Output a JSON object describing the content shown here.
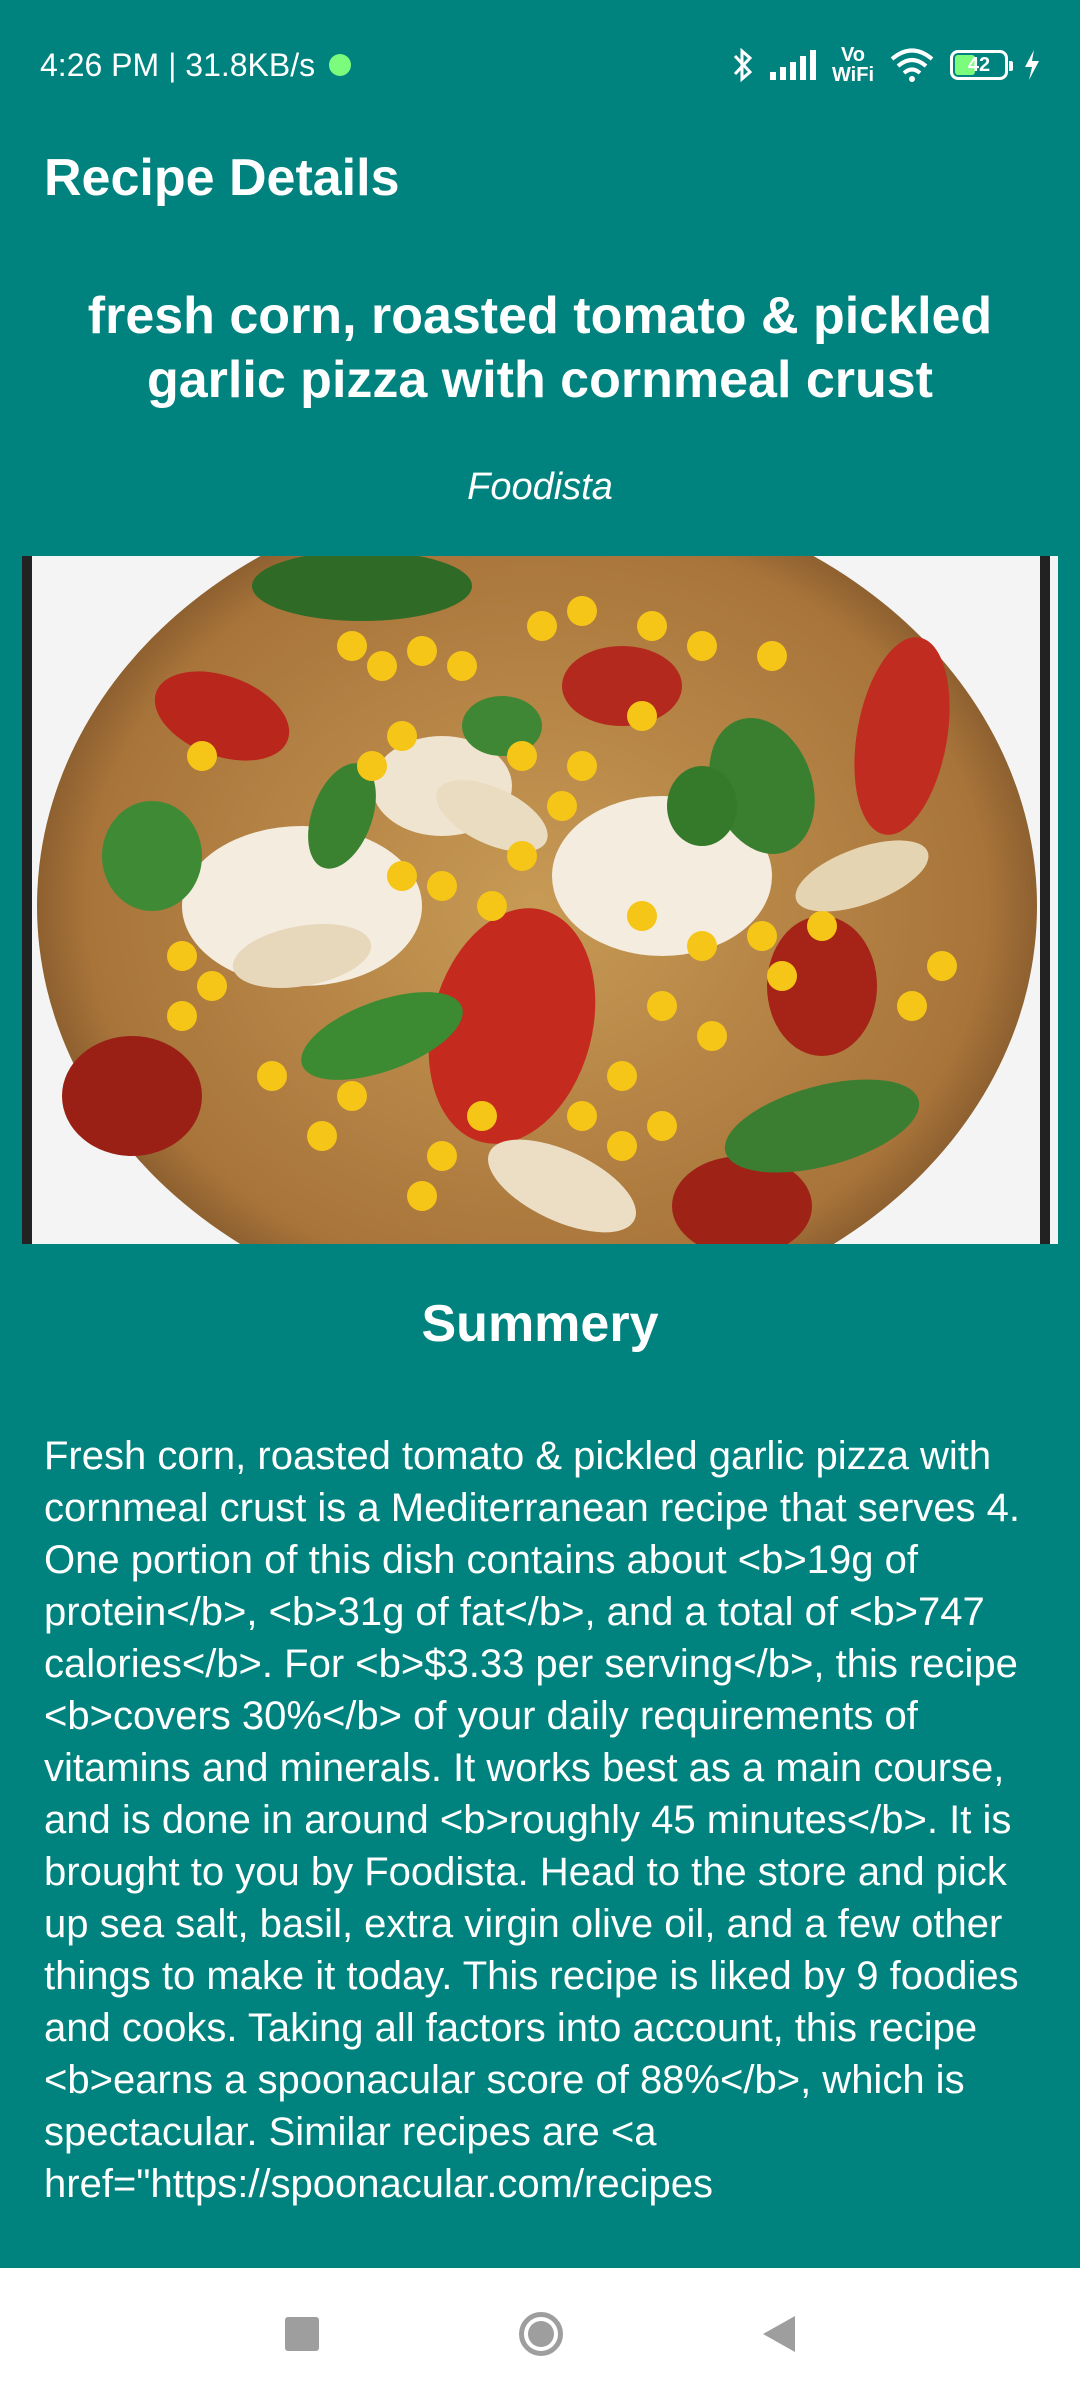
{
  "status_bar": {
    "time_speed": "4:26 PM | 31.8KB/s",
    "vowifi_line1": "Vo",
    "vowifi_line2": "WiFi",
    "battery_level": "42",
    "battery_fraction": 0.42,
    "icons": [
      "notification-dot-icon",
      "bluetooth-icon",
      "signal-icon",
      "wifi-icon",
      "battery-icon",
      "charging-icon"
    ]
  },
  "app_bar": {
    "title": "Recipe Details"
  },
  "recipe": {
    "title": "fresh corn, roasted tomato & pickled garlic pizza with cornmeal crust",
    "source": "Foodista",
    "summary_heading": "Summery",
    "summary": "Fresh corn, roasted tomato & pickled garlic pizza with cornmeal crust is a Mediterranean recipe that serves 4. One portion of this dish contains about <b>19g of protein</b>, <b>31g of fat</b>, and a total of <b>747 calories</b>. For <b>$3.33 per serving</b>, this recipe <b>covers 30%</b> of your daily requirements of vitamins and minerals. It works best as a main course, and is done in around <b>roughly 45 minutes</b>. It is brought to you by Foodista. Head to the store and pick up sea salt, basil, extra virgin olive oil, and a few other things to make it today. This recipe is liked by 9 foodies and cooks. Taking all factors into account, this recipe <b>earns a spoonacular score of 88%</b>, which is spectacular. Similar recipes are <a href=\"https://spoonacular.com/recipes"
  },
  "colors": {
    "background": "#00837F",
    "text": "#FFFFFF",
    "nav_bar": "#FFFFFF",
    "nav_icons": "#9E9E9E"
  }
}
